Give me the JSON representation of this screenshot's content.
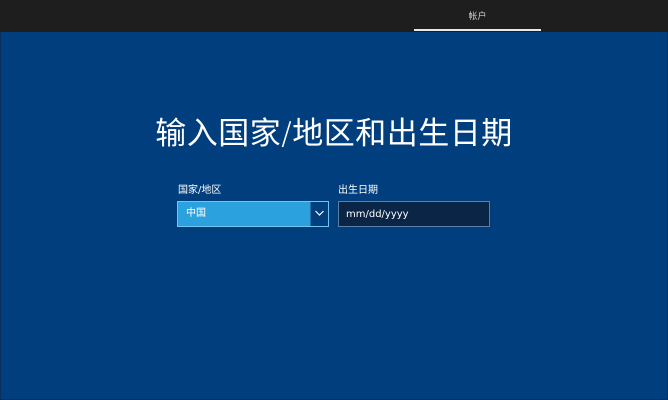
{
  "header": {
    "tabs": [
      {
        "label": "帐户",
        "active": true
      }
    ]
  },
  "main": {
    "title": "输入国家/地区和出生日期",
    "country": {
      "label": "国家/地区",
      "selected": "中国"
    },
    "birthdate": {
      "label": "出生日期",
      "placeholder": "mm/dd/yyyy",
      "value": ""
    }
  },
  "colors": {
    "background": "#003e7e",
    "topbar": "#1e1e1e",
    "select_fill": "#2ba2dd",
    "input_fill": "#0b2547"
  },
  "icons": {
    "dropdown": "chevron-down-icon"
  }
}
